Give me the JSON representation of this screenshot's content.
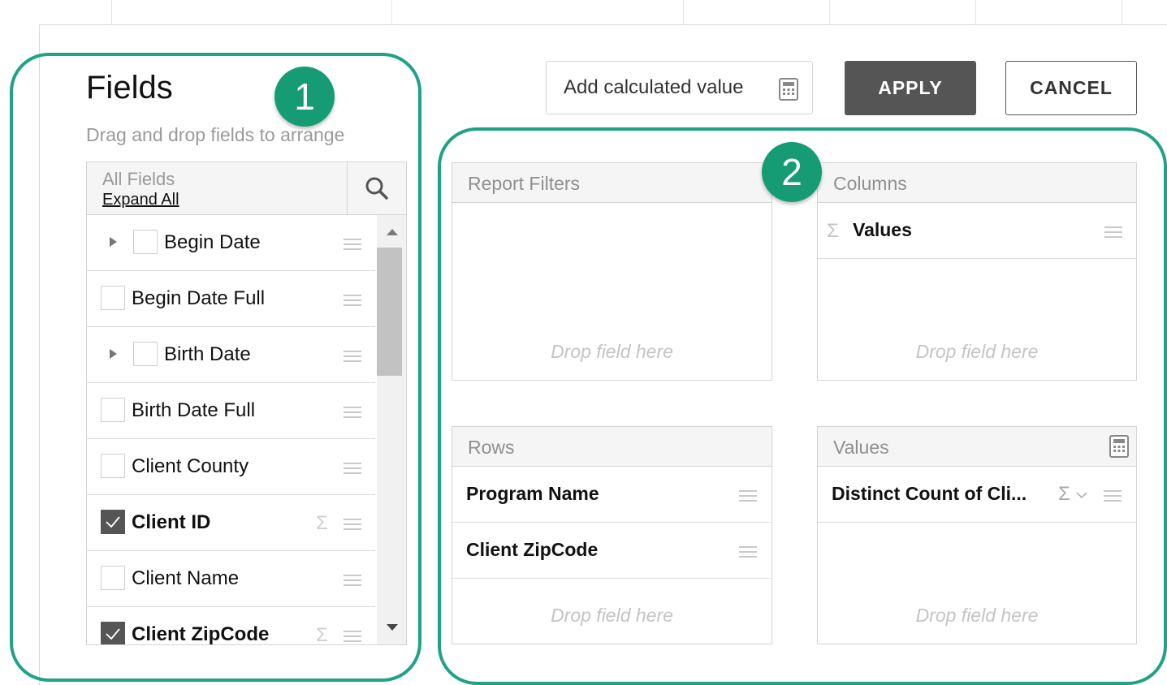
{
  "header": {
    "title": "Fields",
    "subtitle": "Drag and drop fields to arrange"
  },
  "field_list": {
    "header_title": "All Fields",
    "expand_all": "Expand All",
    "fields": [
      {
        "label": "Begin Date",
        "checked": false,
        "expandable": true,
        "bold": false,
        "sigma": false
      },
      {
        "label": "Begin Date Full",
        "checked": false,
        "expandable": false,
        "bold": false,
        "sigma": false
      },
      {
        "label": "Birth Date",
        "checked": false,
        "expandable": true,
        "bold": false,
        "sigma": false
      },
      {
        "label": "Birth Date Full",
        "checked": false,
        "expandable": false,
        "bold": false,
        "sigma": false
      },
      {
        "label": "Client County",
        "checked": false,
        "expandable": false,
        "bold": false,
        "sigma": false
      },
      {
        "label": "Client ID",
        "checked": true,
        "expandable": false,
        "bold": true,
        "sigma": true
      },
      {
        "label": "Client Name",
        "checked": false,
        "expandable": false,
        "bold": false,
        "sigma": false
      },
      {
        "label": "Client ZipCode",
        "checked": true,
        "expandable": false,
        "bold": true,
        "sigma": true
      }
    ],
    "sigma_symbol": "Σ"
  },
  "toolbar": {
    "add_calculated": "Add calculated value",
    "apply": "APPLY",
    "cancel": "CANCEL"
  },
  "zones": {
    "report_filters": {
      "title": "Report Filters",
      "drop": "Drop field here"
    },
    "columns": {
      "title": "Columns",
      "items": [
        "Values"
      ],
      "drop": "Drop field here",
      "sigma_symbol": "Σ"
    },
    "rows": {
      "title": "Rows",
      "items": [
        "Program Name",
        "Client ZipCode"
      ],
      "drop": "Drop field here"
    },
    "values": {
      "title": "Values",
      "items": [
        "Distinct Count of Cli..."
      ],
      "drop": "Drop field here",
      "sigma_symbol": "Σ"
    }
  },
  "callouts": {
    "one": "1",
    "two": "2"
  },
  "colors": {
    "accent": "#1fa287",
    "badge": "#169c74",
    "apply_bg": "#555555"
  }
}
